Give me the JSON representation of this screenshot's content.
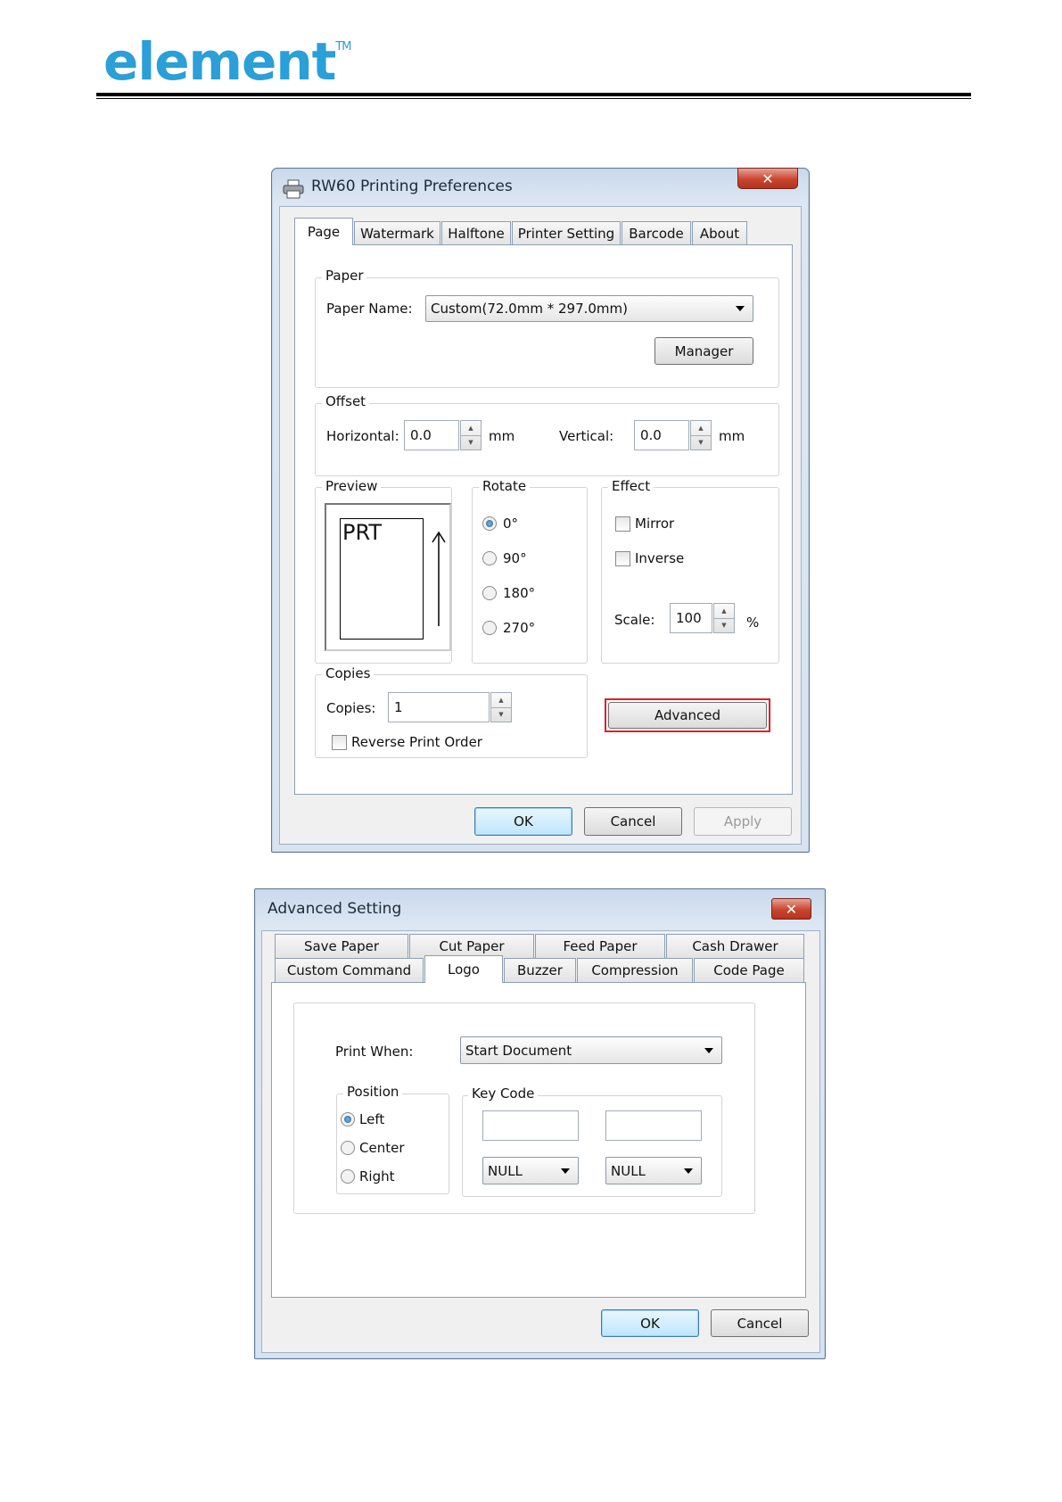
{
  "header": {
    "logo_text": "element",
    "logo_tm": "TM"
  },
  "dialog1": {
    "title": "RW60 Printing Preferences",
    "close_label": "✕",
    "tabs": [
      "Page",
      "Watermark",
      "Halftone",
      "Printer Setting",
      "Barcode",
      "About"
    ],
    "active_tab": "Page",
    "paper": {
      "legend": "Paper",
      "name_label": "Paper Name:",
      "name_value": "Custom(72.0mm * 297.0mm)",
      "manager_label": "Manager"
    },
    "offset": {
      "legend": "Offset",
      "horizontal_label": "Horizontal:",
      "horizontal_value": "0.0",
      "vertical_label": "Vertical:",
      "vertical_value": "0.0",
      "unit": "mm"
    },
    "preview": {
      "legend": "Preview",
      "page_text": "PRT"
    },
    "rotate": {
      "legend": "Rotate",
      "options": [
        "0°",
        "90°",
        "180°",
        "270°"
      ],
      "selected": "0°"
    },
    "effect": {
      "legend": "Effect",
      "mirror_label": "Mirror",
      "inverse_label": "Inverse",
      "scale_label": "Scale:",
      "scale_value": "100",
      "scale_unit": "%"
    },
    "copies": {
      "legend": "Copies",
      "copies_label": "Copies:",
      "copies_value": "1",
      "reverse_label": "Reverse Print Order"
    },
    "advanced_label": "Advanced",
    "buttons": {
      "ok": "OK",
      "cancel": "Cancel",
      "apply": "Apply"
    }
  },
  "dialog2": {
    "title": "Advanced Setting",
    "close_label": "✕",
    "tabs_row1": [
      "Save Paper",
      "Cut Paper",
      "Feed Paper",
      "Cash Drawer"
    ],
    "tabs_row2": [
      "Custom Command",
      "Logo",
      "Buzzer",
      "Compression",
      "Code Page"
    ],
    "active_tab": "Logo",
    "print_when_label": "Print When:",
    "print_when_value": "Start Document",
    "position": {
      "legend": "Position",
      "options": [
        "Left",
        "Center",
        "Right"
      ],
      "selected": "Left"
    },
    "key_code": {
      "legend": "Key Code",
      "field1_value": "",
      "field2_value": "",
      "select1_value": "NULL",
      "select2_value": "NULL"
    },
    "buttons": {
      "ok": "OK",
      "cancel": "Cancel"
    }
  }
}
